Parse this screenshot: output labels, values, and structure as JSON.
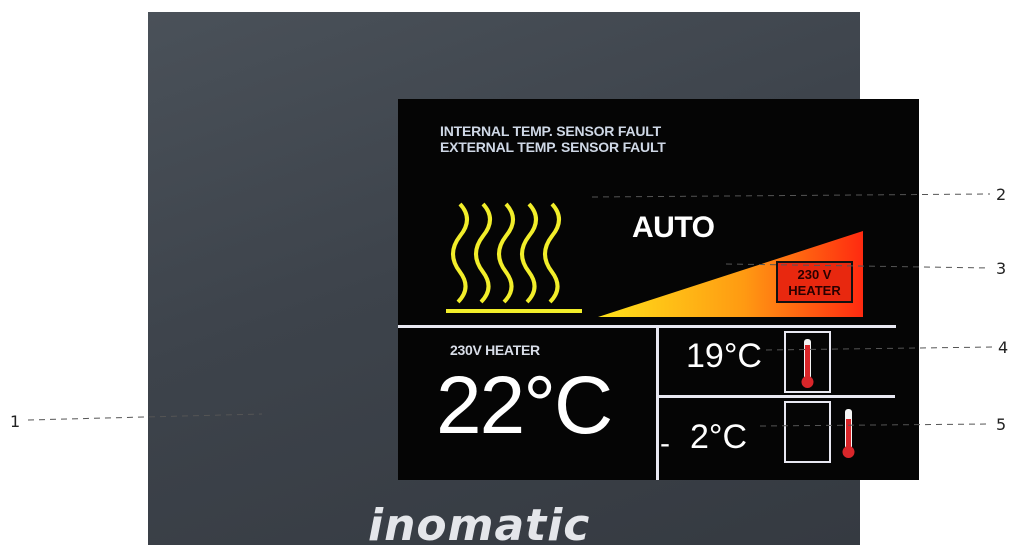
{
  "faults": [
    "INTERNAL TEMP. SENSOR FAULT",
    "EXTERNAL TEMP. SENSOR FAULT"
  ],
  "mode": "AUTO",
  "power_badge": [
    "230 V",
    "HEATER"
  ],
  "heater_label": "230V HEATER",
  "main_temp": "22°C",
  "indoor_temp": "19°C",
  "outdoor_sign": "-",
  "outdoor_temp": "2°C",
  "brand": "inomatic",
  "callouts": [
    "1",
    "2",
    "3",
    "4",
    "5"
  ],
  "colors": {
    "wave": "#f2ee2a",
    "ramp_start": "#ffe21a",
    "ramp_end": "#ff2a10",
    "thermometer": "#d9262a"
  },
  "icons": [
    "heat-waves-icon",
    "power-ramp-icon",
    "thermometer-icon"
  ]
}
